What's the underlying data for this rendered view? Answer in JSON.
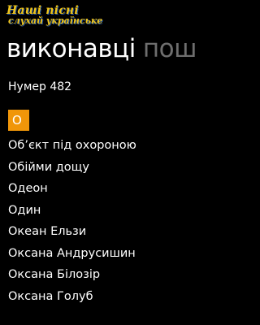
{
  "app": {
    "logo_line1": "Наші пісні",
    "logo_line2": "слухай українське"
  },
  "pivot": {
    "active": "виконавці",
    "next": "пош"
  },
  "group": {
    "title": "Нумер 482",
    "letter": "О"
  },
  "artists": [
    "Об’єкт під охороною",
    "Обійми дощу",
    "Одеон",
    "Один",
    "Океан Ельзи",
    "Оксана Андрусишин",
    "Оксана Білозір",
    "Оксана Голуб"
  ],
  "colors": {
    "accent": "#f09609",
    "logo_yellow": "#f0c419",
    "logo_blue": "#1c4fa0",
    "inactive_pivot": "#6e6e6e"
  }
}
